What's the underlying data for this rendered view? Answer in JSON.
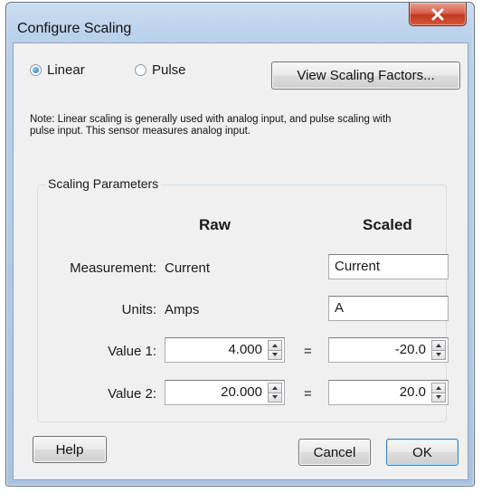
{
  "window": {
    "title": "Configure Scaling"
  },
  "mode": {
    "options": [
      {
        "label": "Linear",
        "selected": true
      },
      {
        "label": "Pulse",
        "selected": false
      }
    ],
    "view_factors_label": "View Scaling Factors..."
  },
  "note": "Note: Linear scaling is generally used with analog input, and pulse scaling with pulse input. This sensor measures analog input.",
  "params": {
    "group_title": "Scaling Parameters",
    "raw_header": "Raw",
    "scaled_header": "Scaled",
    "measurement": {
      "label": "Measurement:",
      "raw": "Current",
      "scaled": "Current"
    },
    "units": {
      "label": "Units:",
      "raw": "Amps",
      "scaled": "A"
    },
    "value1": {
      "label": "Value 1:",
      "raw": "4.000",
      "scaled": "-20.0"
    },
    "value2": {
      "label": "Value 2:",
      "raw": "20.000",
      "scaled": "20.0"
    },
    "equals": "="
  },
  "buttons": {
    "help": "Help",
    "cancel": "Cancel",
    "ok": "OK"
  },
  "colors": {
    "titlebar": "#b9d0ea",
    "close_button": "#c94a36",
    "dialog_face": "#f0f0f0"
  }
}
